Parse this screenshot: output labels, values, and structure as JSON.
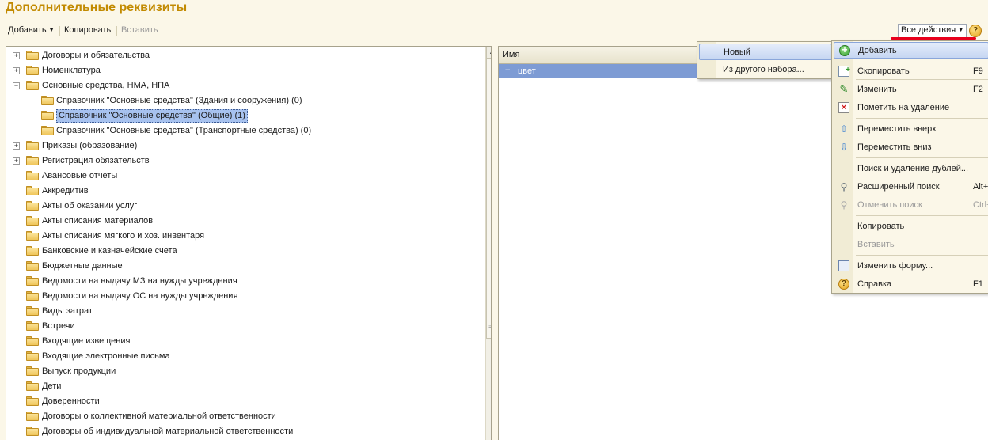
{
  "window": {
    "title": "Дополнительные реквизиты"
  },
  "toolbar": {
    "add_label": "Добавить",
    "copy_label": "Копировать",
    "paste_label": "Вставить",
    "all_actions_label": "Все действия",
    "help_label": "?"
  },
  "tree": {
    "items": [
      {
        "label": "Договоры и обязательства",
        "expander": "+"
      },
      {
        "label": "Номенклатура",
        "expander": "+"
      },
      {
        "label": "Основные средства, НМА, НПА",
        "expander": "−"
      },
      {
        "label": "Справочник \"Основные средства\" (Здания и сооружения) (0)"
      },
      {
        "label": "Справочник \"Основные средства\" (Общие) (1)"
      },
      {
        "label": "Справочник \"Основные средства\" (Транспортные средства) (0)"
      },
      {
        "label": "Приказы (образование)",
        "expander": "+"
      },
      {
        "label": "Регистрация обязательств",
        "expander": "+"
      },
      {
        "label": "Авансовые отчеты"
      },
      {
        "label": "Аккредитив"
      },
      {
        "label": "Акты об оказании услуг"
      },
      {
        "label": "Акты списания материалов"
      },
      {
        "label": "Акты списания мягкого и хоз. инвентаря"
      },
      {
        "label": "Банковские и казначейские счета"
      },
      {
        "label": "Бюджетные данные"
      },
      {
        "label": "Ведомости на выдачу МЗ на нужды учреждения"
      },
      {
        "label": "Ведомости на выдачу ОС на нужды учреждения"
      },
      {
        "label": "Виды затрат"
      },
      {
        "label": "Встречи"
      },
      {
        "label": "Входящие извещения"
      },
      {
        "label": "Входящие электронные письма"
      },
      {
        "label": "Выпуск продукции"
      },
      {
        "label": "Дети"
      },
      {
        "label": "Доверенности"
      },
      {
        "label": "Договоры о коллективной материальной ответственности"
      },
      {
        "label": "Договоры об индивидуальной материальной ответственности"
      }
    ]
  },
  "grid": {
    "column_header": "Имя",
    "rows": [
      {
        "expander": "−",
        "name": "цвет"
      }
    ]
  },
  "add_submenu": {
    "items": [
      {
        "label": "Новый"
      },
      {
        "label": "Из другого набора..."
      }
    ]
  },
  "context_menu": {
    "items": [
      {
        "label": "Добавить",
        "shortcut": "",
        "icon": "add-icon"
      },
      {
        "label": "Скопировать",
        "shortcut": "F9",
        "icon": "copy-icon"
      },
      {
        "label": "Изменить",
        "shortcut": "F2",
        "icon": "edit-icon"
      },
      {
        "label": "Пометить на удаление",
        "shortcut": "",
        "icon": "delete-mark-icon"
      },
      {
        "label": "Переместить вверх",
        "shortcut": "",
        "icon": "arrow-up-icon"
      },
      {
        "label": "Переместить вниз",
        "shortcut": "",
        "icon": "arrow-down-icon"
      },
      {
        "label": "Поиск и удаление дублей...",
        "shortcut": "",
        "icon": ""
      },
      {
        "label": "Расширенный поиск",
        "shortcut": "Alt+F",
        "icon": "search-icon"
      },
      {
        "label": "Отменить поиск",
        "shortcut": "Ctrl+Q",
        "icon": "cancel-search-icon"
      },
      {
        "label": "Копировать",
        "shortcut": "",
        "icon": ""
      },
      {
        "label": "Вставить",
        "shortcut": "",
        "icon": ""
      },
      {
        "label": "Изменить форму...",
        "shortcut": "",
        "icon": "form-icon"
      },
      {
        "label": "Справка",
        "shortcut": "F1",
        "icon": "help-icon"
      }
    ]
  }
}
